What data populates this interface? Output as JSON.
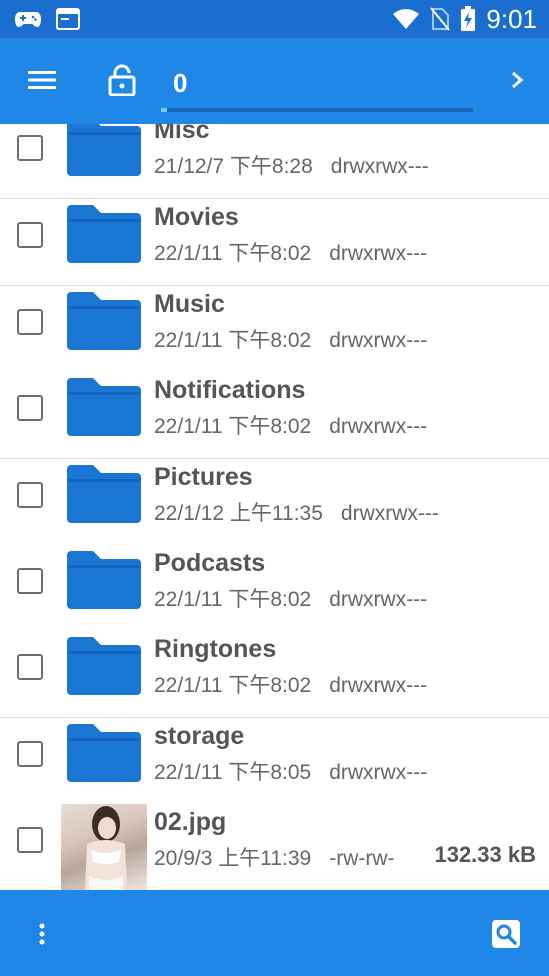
{
  "status_bar": {
    "left_icons": [
      "gamepad-icon",
      "terminal-icon"
    ],
    "right_icons": [
      "wifi-icon",
      "no-sim-icon",
      "battery-charging-icon"
    ],
    "time": "9:01"
  },
  "toolbar": {
    "menu_icon": "menu-icon",
    "lock_icon": "lock-open-icon",
    "path": "0",
    "next_icon": "chevron-right-icon"
  },
  "files": [
    {
      "name": "Misc",
      "date": "21/12/7 下午8:28",
      "perm": "drwxrwx---",
      "type": "folder"
    },
    {
      "name": "Movies",
      "date": "22/1/11 下午8:02",
      "perm": "drwxrwx---",
      "type": "folder"
    },
    {
      "name": "Music",
      "date": "22/1/11 下午8:02",
      "perm": "drwxrwx---",
      "type": "folder"
    },
    {
      "name": "Notifications",
      "date": "22/1/11 下午8:02",
      "perm": "drwxrwx---",
      "type": "folder"
    },
    {
      "name": "Pictures",
      "date": "22/1/12 上午11:35",
      "perm": "drwxrwx---",
      "type": "folder"
    },
    {
      "name": "Podcasts",
      "date": "22/1/11 下午8:02",
      "perm": "drwxrwx---",
      "type": "folder"
    },
    {
      "name": "Ringtones",
      "date": "22/1/11 下午8:02",
      "perm": "drwxrwx---",
      "type": "folder"
    },
    {
      "name": "storage",
      "date": "22/1/11 下午8:05",
      "perm": "drwxrwx---",
      "type": "folder"
    },
    {
      "name": "02.jpg",
      "date": "20/9/3 上午11:39",
      "perm": "-rw-rw-",
      "size": "132.33 kB",
      "type": "image"
    }
  ],
  "bottom_bar": {
    "more_icon": "more-vertical-icon",
    "search_icon": "search-icon"
  },
  "colors": {
    "status_bar": "#1a6ed0",
    "toolbar": "#1f87e5",
    "folder": "#1976d2"
  }
}
